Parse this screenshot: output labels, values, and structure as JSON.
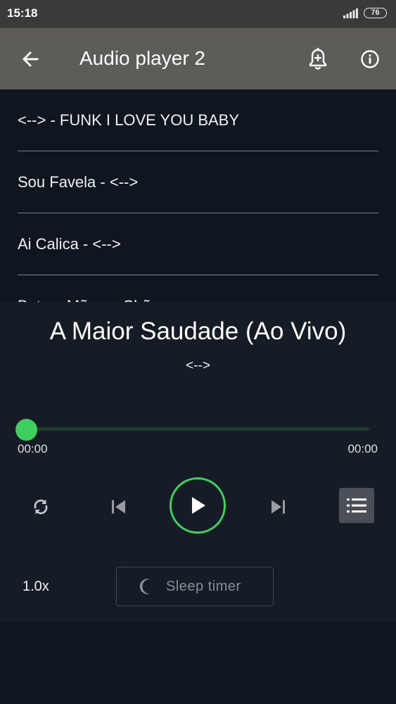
{
  "status_bar": {
    "time": "15:18",
    "battery": "76"
  },
  "app_bar": {
    "title": "Audio player 2"
  },
  "playlist": [
    {
      "label": "<--> - FUNK I LOVE YOU BABY"
    },
    {
      "label": "Sou Favela - <-->"
    },
    {
      "label": "Ai Calica - <-->"
    },
    {
      "label": "Bota a Mão no Chão - <-->"
    }
  ],
  "now_playing": {
    "title": "A Maior Saudade (Ao Vivo)",
    "artist": "<-->",
    "position": "00:00",
    "duration": "00:00",
    "progress": 0
  },
  "controls": {
    "speed": "1.0x",
    "sleep_label": "Sleep timer"
  },
  "colors": {
    "accent": "#3ecf5e",
    "app_bar": "#5e5c59",
    "background": "#101620",
    "player_background": "#161c26"
  },
  "icons": {
    "back": "arrow-left-icon",
    "alarm": "bell-plus-icon",
    "info": "info-icon",
    "repeat": "repeat-icon",
    "previous": "skip-previous-icon",
    "play": "play-icon",
    "next": "skip-next-icon",
    "playlist": "list-icon",
    "sleep": "moon-icon"
  }
}
